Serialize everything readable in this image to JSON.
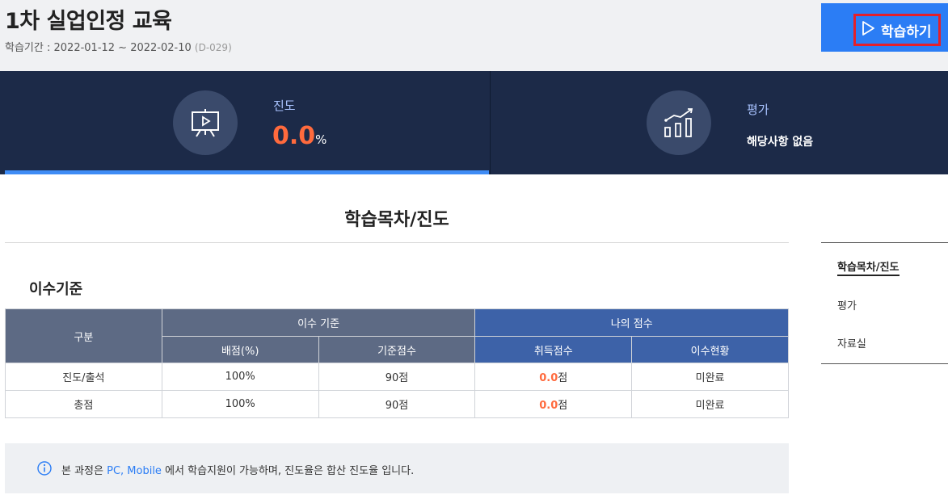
{
  "course": {
    "title": "1차 실업인정 교육",
    "period_label": "학습기간 : ",
    "period_value": "2022-01-12 ~ 2022-02-10",
    "dday": "(D-029)",
    "study_button_label": "학습하기"
  },
  "stats": {
    "progress_label": "진도",
    "progress_value": "0.0",
    "progress_unit": "%",
    "eval_label": "평가",
    "eval_value": "해당사항 없음"
  },
  "section": {
    "title": "학습목차/진도",
    "subtitle": "이수기준"
  },
  "side_nav": {
    "items": [
      {
        "label": "학습목차/진도"
      },
      {
        "label": "평가"
      },
      {
        "label": "자료실"
      }
    ]
  },
  "table": {
    "header": {
      "category": "구분",
      "criteria_group": "이수 기준",
      "my_score_group": "나의 점수",
      "weight": "배점(%)",
      "standard": "기준점수",
      "acquired": "취득점수",
      "status": "이수현황"
    },
    "rows": [
      {
        "category": "진도/출석",
        "weight": "100%",
        "standard": "90점",
        "acquired": "0.0",
        "acquired_unit": "점",
        "status": "미완료"
      },
      {
        "category": "총점",
        "weight": "100%",
        "standard": "90점",
        "acquired": "0.0",
        "acquired_unit": "점",
        "status": "미완료"
      }
    ]
  },
  "notice": {
    "pre": "본 과정은 ",
    "highlight": "PC, Mobile",
    "post": " 에서 학습지원이 가능하며, 진도율은 합산 진도율 입니다."
  },
  "colors": {
    "primary": "#2b7df5",
    "dark_bar": "#1c2a48",
    "accent_orange": "#ff6a3d",
    "highlight_red": "#e4202a"
  }
}
